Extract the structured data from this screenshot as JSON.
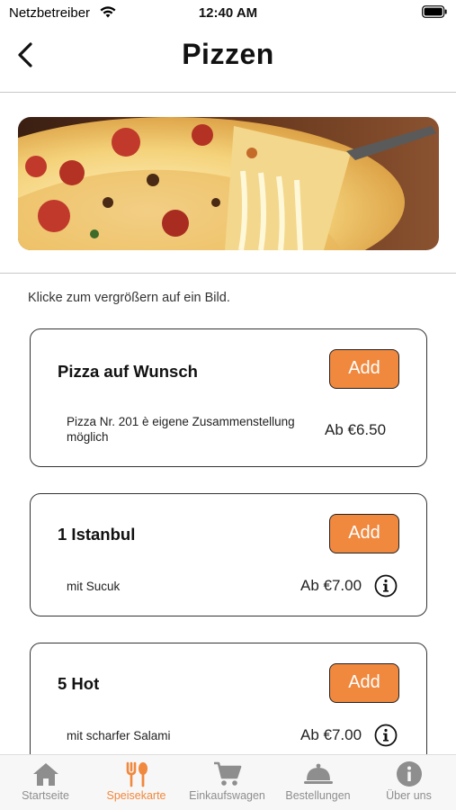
{
  "status_bar": {
    "carrier": "Netzbetreiber",
    "time": "12:40 AM"
  },
  "header": {
    "title": "Pizzen"
  },
  "hint": "Klicke zum vergrößern auf ein Bild.",
  "products": [
    {
      "name": "Pizza auf Wunsch",
      "description": "Pizza Nr. 201 è eigene Zusammenstellung möglich",
      "price": "Ab €6.50",
      "add_label": "Add"
    },
    {
      "name": "1 Istanbul",
      "description": "mit Sucuk",
      "price": "Ab €7.00",
      "add_label": "Add"
    },
    {
      "name": "5 Hot",
      "description": "mit scharfer Salami",
      "price": "Ab €7.00",
      "add_label": "Add"
    }
  ],
  "tabs": [
    {
      "label": "Startseite",
      "icon": "home-icon"
    },
    {
      "label": "Speisekarte",
      "icon": "fork-spoon-icon",
      "active": true
    },
    {
      "label": "Einkaufswagen",
      "icon": "cart-icon"
    },
    {
      "label": "Bestellungen",
      "icon": "cloche-icon"
    },
    {
      "label": "Über uns",
      "icon": "info-icon"
    }
  ],
  "colors": {
    "accent": "#f0883e",
    "tab_inactive": "#8e8e8e"
  }
}
